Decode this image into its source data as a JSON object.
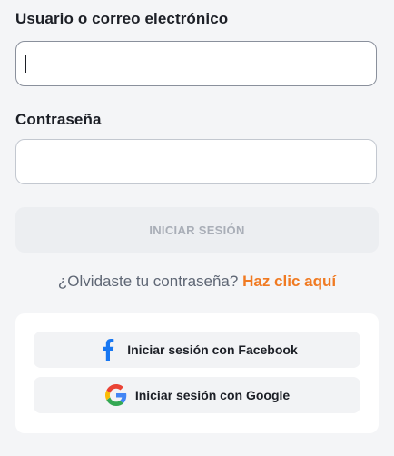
{
  "form": {
    "username_label": "Usuario o correo electrónico",
    "username_value": "",
    "password_label": "Contraseña",
    "password_value": "",
    "login_button": "INICIAR SESIÓN",
    "forgot_text": "¿Olvidaste tu contraseña?",
    "forgot_link": "Haz clic aquí"
  },
  "social": {
    "facebook_label": "Iniciar sesión con Facebook",
    "google_label": "Iniciar sesión con Google"
  },
  "colors": {
    "accent": "#f07a22",
    "facebook": "#1877f2",
    "background": "#f4f5f7",
    "button_disabled_bg": "#eceef1",
    "button_disabled_text": "#a9aeb7"
  },
  "icons": {
    "facebook": "facebook-icon",
    "google": "google-icon"
  }
}
